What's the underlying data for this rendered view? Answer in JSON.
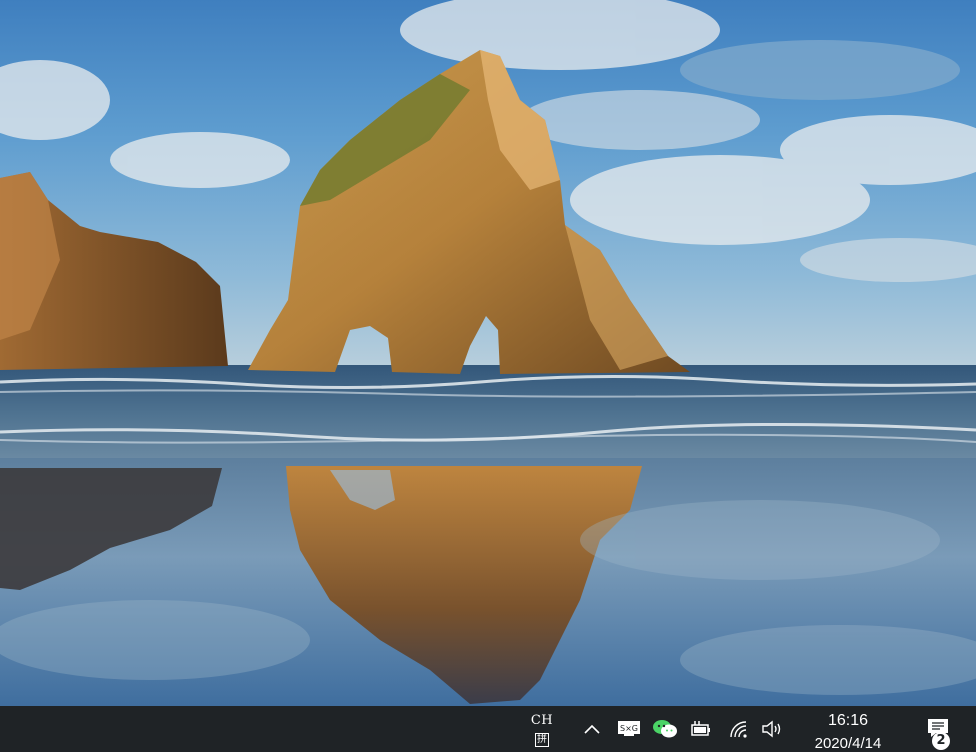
{
  "desktop": {
    "wallpaper": "windows-10-beach-rock-arch-wallpaper"
  },
  "taskbar": {
    "ime": {
      "language": "CH",
      "mode": "拼"
    },
    "tray_icons": [
      "chevron-up-icon",
      "sogou-input-icon",
      "wechat-icon",
      "power-battery-icon",
      "wifi-icon",
      "volume-icon"
    ],
    "clock": {
      "time": "16:16",
      "date": "2020/4/14"
    },
    "notifications": {
      "count": "2"
    }
  },
  "colors": {
    "taskbar": "#1f2326",
    "text": "#ffffff",
    "wechat": "#4bd366"
  }
}
